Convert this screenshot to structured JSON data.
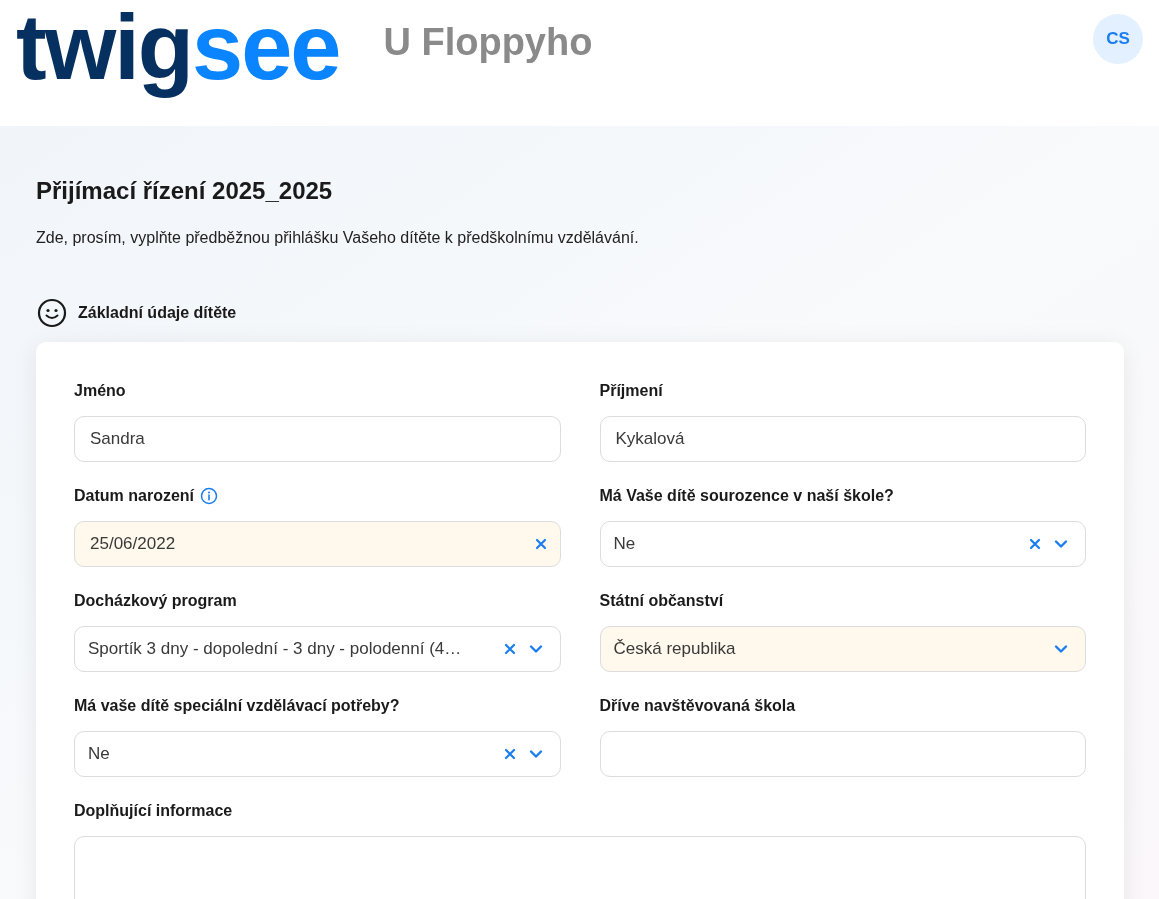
{
  "header": {
    "logo": {
      "dark": "twig",
      "accent": "see"
    },
    "school": "U Floppyho",
    "avatar": "CS"
  },
  "page": {
    "title": "Přijímací řízení 2025_2025",
    "description": "Zde, prosím, vyplňte předběžnou přihlášku Vašeho dítěte k předškolnímu vzdělávání."
  },
  "section": {
    "title": "Základní údaje dítěte"
  },
  "fields": [
    {
      "label": "Jméno",
      "kind": "text",
      "value": "Sandra",
      "highlighted": false,
      "clearable": false,
      "info": false
    },
    {
      "label": "Příjmení",
      "kind": "text",
      "value": "Kykalová",
      "highlighted": false,
      "clearable": false,
      "info": false
    },
    {
      "label": "Datum narození",
      "kind": "date",
      "value": "25/06/2022",
      "highlighted": true,
      "clearable": true,
      "info": true
    },
    {
      "label": "Má Vaše dítě sourozence v naší škole?",
      "kind": "select",
      "value": "Ne",
      "highlighted": false,
      "clearable": true,
      "info": false
    },
    {
      "label": "Docházkový program",
      "kind": "select",
      "value": "Sportík 3 dny - dopolední - 3 dny - polodenní (4…",
      "highlighted": false,
      "clearable": true,
      "info": false
    },
    {
      "label": "Státní občanství",
      "kind": "select",
      "value": "Česká republika",
      "highlighted": true,
      "clearable": false,
      "info": false
    },
    {
      "label": "Má vaše dítě speciální vzdělávací potřeby?",
      "kind": "select",
      "value": "Ne",
      "highlighted": false,
      "clearable": true,
      "info": false
    },
    {
      "label": "Dříve navštěvovaná škola",
      "kind": "text",
      "highlighted": false,
      "clearable": false,
      "info": false
    },
    {
      "label": "Doplňující informace",
      "kind": "textarea",
      "highlighted": false,
      "clearable": false,
      "info": false
    }
  ]
}
